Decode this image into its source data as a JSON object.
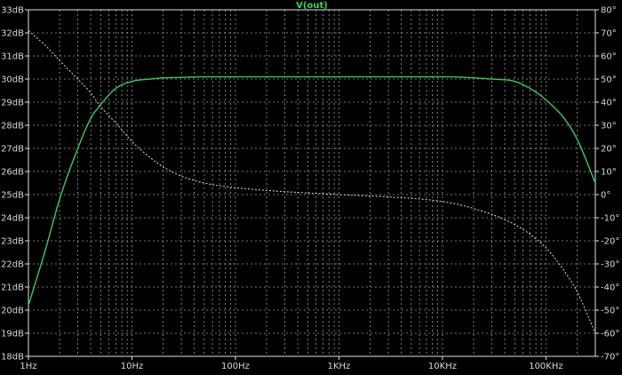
{
  "chart_data": {
    "type": "line",
    "title": "V(out)",
    "xscale": "log",
    "xlim": [
      1,
      300000
    ],
    "x_ticks": [
      {
        "value": 1,
        "label": "1Hz"
      },
      {
        "value": 10,
        "label": "10Hz"
      },
      {
        "value": 100,
        "label": "100Hz"
      },
      {
        "value": 1000,
        "label": "1KHz"
      },
      {
        "value": 10000,
        "label": "10KHz"
      },
      {
        "value": 100000,
        "label": "100KHz"
      }
    ],
    "y_left": {
      "lim": [
        18,
        33
      ],
      "ticks": [
        {
          "value": 33,
          "label": "33dB"
        },
        {
          "value": 32,
          "label": "32dB"
        },
        {
          "value": 31,
          "label": "31dB"
        },
        {
          "value": 30,
          "label": "30dB"
        },
        {
          "value": 29,
          "label": "29dB"
        },
        {
          "value": 28,
          "label": "28dB"
        },
        {
          "value": 27,
          "label": "27dB"
        },
        {
          "value": 26,
          "label": "26dB"
        },
        {
          "value": 25,
          "label": "25dB"
        },
        {
          "value": 24,
          "label": "24dB"
        },
        {
          "value": 23,
          "label": "23dB"
        },
        {
          "value": 22,
          "label": "22dB"
        },
        {
          "value": 21,
          "label": "21dB"
        },
        {
          "value": 20,
          "label": "20dB"
        },
        {
          "value": 19,
          "label": "19dB"
        },
        {
          "value": 18,
          "label": "18dB"
        }
      ]
    },
    "y_right": {
      "lim": [
        -70,
        80
      ],
      "ticks": [
        {
          "value": 80,
          "label": "80°"
        },
        {
          "value": 70,
          "label": "70°"
        },
        {
          "value": 60,
          "label": "60°"
        },
        {
          "value": 50,
          "label": "50°"
        },
        {
          "value": 40,
          "label": "40°"
        },
        {
          "value": 30,
          "label": "30°"
        },
        {
          "value": 20,
          "label": "20°"
        },
        {
          "value": 10,
          "label": "10°"
        },
        {
          "value": 0,
          "label": "0°"
        },
        {
          "value": -10,
          "label": "-10°"
        },
        {
          "value": -20,
          "label": "-20°"
        },
        {
          "value": -30,
          "label": "-30°"
        },
        {
          "value": -40,
          "label": "-40°"
        },
        {
          "value": -50,
          "label": "-50°"
        },
        {
          "value": -60,
          "label": "-60°"
        },
        {
          "value": -70,
          "label": "-70°"
        }
      ]
    },
    "grid": true,
    "series": [
      {
        "axis": "left",
        "style": "solid",
        "color": "#3cc866",
        "x": [
          1,
          1.5,
          2,
          3,
          4,
          5,
          7,
          10,
          15,
          20,
          30,
          50,
          100,
          1000,
          10000,
          30000,
          50000,
          70000,
          100000,
          150000,
          200000,
          300000
        ],
        "y": [
          20.2,
          22.8,
          24.8,
          27.0,
          28.3,
          28.9,
          29.6,
          29.9,
          30.0,
          30.05,
          30.07,
          30.1,
          30.1,
          30.1,
          30.1,
          30.0,
          29.9,
          29.6,
          29.1,
          28.3,
          27.4,
          25.5
        ]
      },
      {
        "axis": "right",
        "style": "dashed",
        "color": "#c8e8c8",
        "x": [
          1,
          1.5,
          2,
          3,
          4,
          5,
          7,
          10,
          15,
          20,
          30,
          50,
          100,
          1000,
          3000,
          10000,
          20000,
          50000,
          100000,
          150000,
          200000,
          300000
        ],
        "y": [
          71,
          64,
          58,
          50,
          44,
          38,
          31,
          23,
          16,
          12,
          8,
          5,
          3,
          0,
          -1,
          -3,
          -6,
          -13,
          -23,
          -33,
          -42,
          -60
        ]
      }
    ]
  }
}
